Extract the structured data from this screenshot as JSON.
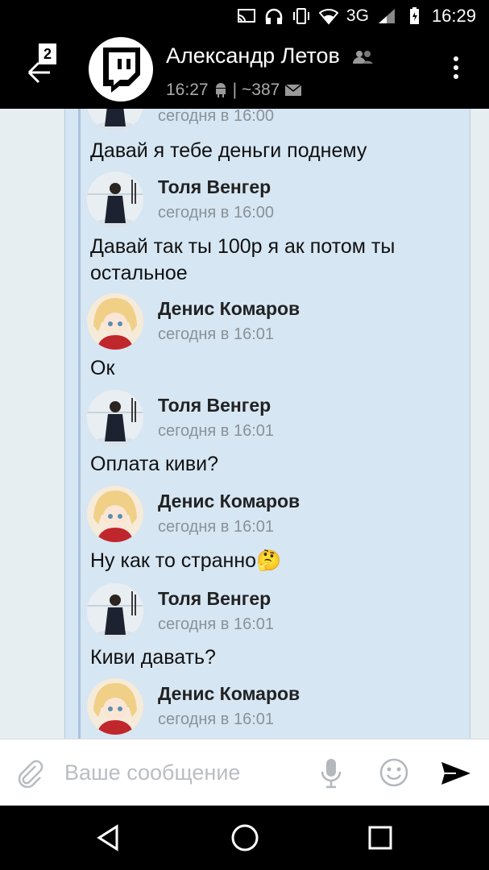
{
  "statusbar": {
    "network": "3G",
    "time": "16:29"
  },
  "header": {
    "back_badge": "2",
    "title": "Александр Летов",
    "subtitle_time": "16:27",
    "subtitle_sep": "|",
    "subtitle_count": "~387"
  },
  "partial": {
    "timestamp": "сегодня в 16:00"
  },
  "messages": [
    {
      "text": "Давай я тебе деньги поднему"
    },
    {
      "author": "Толя Венгер",
      "timestamp": "сегодня в 16:00",
      "text": "Давай так ты 100р я ак потом ты остальное"
    },
    {
      "author": "Денис Комаров",
      "timestamp": "сегодня в 16:01",
      "text": "Ок"
    },
    {
      "author": "Толя Венгер",
      "timestamp": "сегодня в 16:01",
      "text": "Оплата киви?"
    },
    {
      "author": "Денис Комаров",
      "timestamp": "сегодня в 16:01",
      "text": "Ну как то странно🤔"
    },
    {
      "author": "Толя Венгер",
      "timestamp": "сегодня в 16:01",
      "text": "Киви давать?"
    },
    {
      "author": "Денис Комаров",
      "timestamp": "сегодня в 16:01"
    }
  ],
  "input": {
    "placeholder": "Ваше сообщение"
  },
  "colors": {
    "header_bg": "#000000",
    "chat_bg": "#e6eef2",
    "forward_bg": "#d6e6f3",
    "muted_text": "#8a9198"
  },
  "icons": [
    "cast-icon",
    "headphones-icon",
    "vibrate-icon",
    "wifi-icon",
    "signal-icon",
    "battery-icon",
    "back-arrow-icon",
    "twitch-logo-icon",
    "group-icon",
    "android-icon",
    "mail-icon",
    "more-icon",
    "attach-icon",
    "mic-icon",
    "smile-icon",
    "send-icon",
    "nav-back-icon",
    "nav-home-icon",
    "nav-recents-icon"
  ]
}
